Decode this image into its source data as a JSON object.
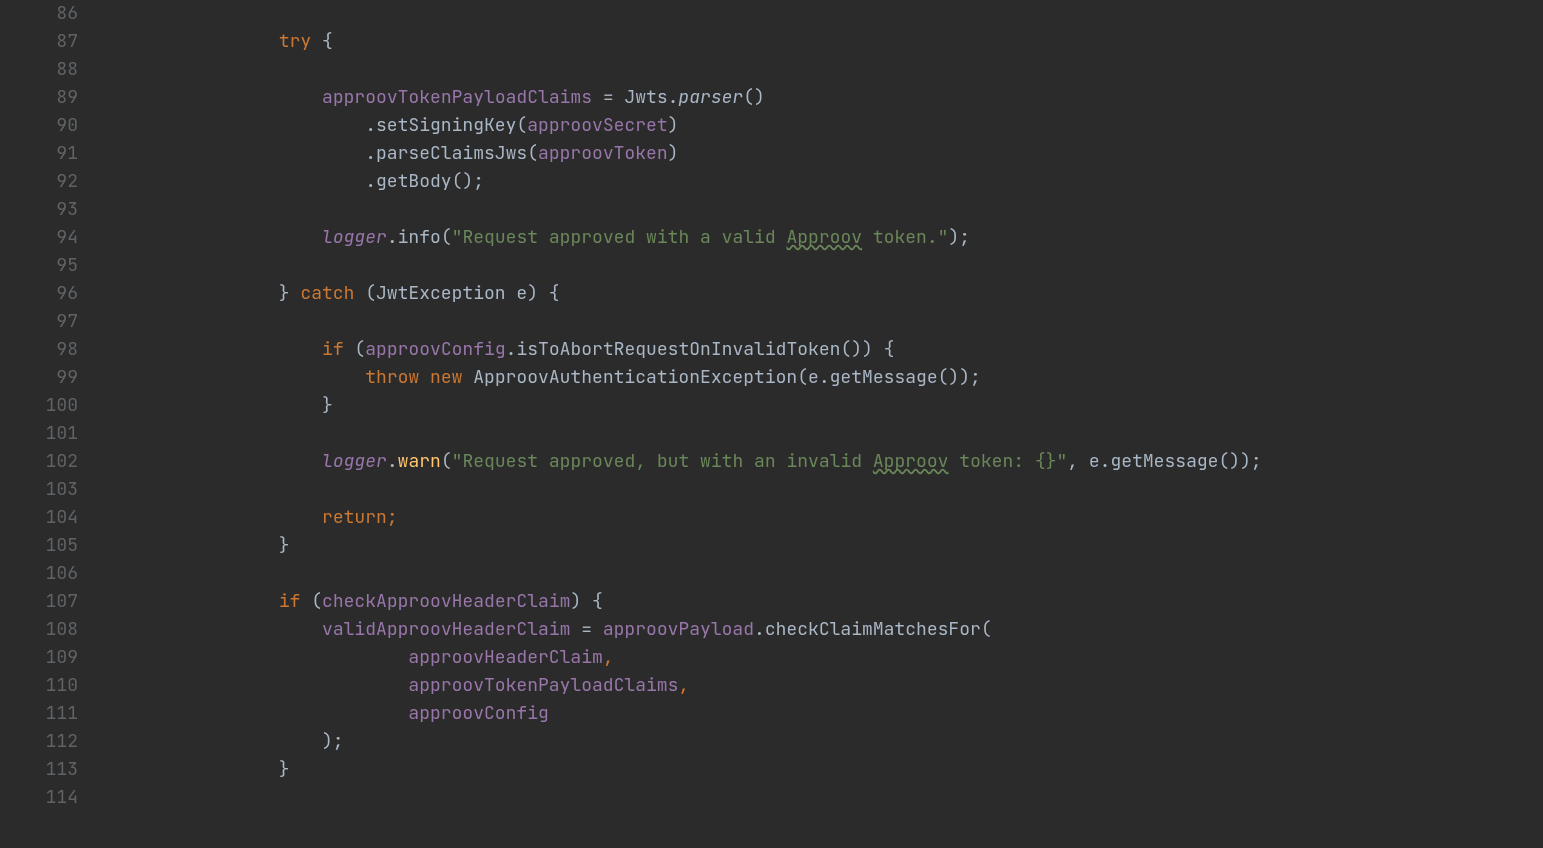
{
  "code_language": "java",
  "first_line_number": 86,
  "theme": {
    "background": "#2b2b2b",
    "default_text": "#A9B7C6",
    "gutter_text": "#606366",
    "keyword": "#CC7832",
    "identifier": "#A9B7C6",
    "field_variable": "#9876AA",
    "method_call": "#FFC66D",
    "string_literal": "#6A8759"
  },
  "lines": [
    {
      "n": 86,
      "tokens": []
    },
    {
      "n": 87,
      "tokens": [
        {
          "t": "        ",
          "c": "tok-id"
        },
        {
          "t": "try",
          "c": "tok-kw"
        },
        {
          "t": " {",
          "c": "tok-id"
        }
      ]
    },
    {
      "n": 88,
      "tokens": []
    },
    {
      "n": 89,
      "tokens": [
        {
          "t": "            ",
          "c": "tok-id"
        },
        {
          "t": "approovTokenPayloadClaims",
          "c": "tok-var"
        },
        {
          "t": " = Jwts.",
          "c": "tok-id"
        },
        {
          "t": "parser",
          "c": "tok-static-it"
        },
        {
          "t": "()",
          "c": "tok-id"
        }
      ]
    },
    {
      "n": 90,
      "tokens": [
        {
          "t": "                .setSigningKey(",
          "c": "tok-id"
        },
        {
          "t": "approovSecret",
          "c": "tok-var"
        },
        {
          "t": ")",
          "c": "tok-id"
        }
      ]
    },
    {
      "n": 91,
      "tokens": [
        {
          "t": "                .parseClaimsJws(",
          "c": "tok-id"
        },
        {
          "t": "approovToken",
          "c": "tok-var"
        },
        {
          "t": ")",
          "c": "tok-id"
        }
      ]
    },
    {
      "n": 92,
      "tokens": [
        {
          "t": "                .getBody();",
          "c": "tok-id"
        }
      ]
    },
    {
      "n": 93,
      "tokens": []
    },
    {
      "n": 94,
      "tokens": [
        {
          "t": "            ",
          "c": "tok-id"
        },
        {
          "t": "logger",
          "c": "tok-field-it"
        },
        {
          "t": ".info(",
          "c": "tok-id"
        },
        {
          "t": "\"Request approved with a valid ",
          "c": "tok-str"
        },
        {
          "t": "Approov",
          "c": "tok-spell"
        },
        {
          "t": " token.\"",
          "c": "tok-str"
        },
        {
          "t": ");",
          "c": "tok-id"
        }
      ]
    },
    {
      "n": 95,
      "tokens": []
    },
    {
      "n": 96,
      "tokens": [
        {
          "t": "        } ",
          "c": "tok-id"
        },
        {
          "t": "catch",
          "c": "tok-kw"
        },
        {
          "t": " (JwtException e) {",
          "c": "tok-id"
        }
      ]
    },
    {
      "n": 97,
      "tokens": []
    },
    {
      "n": 98,
      "tokens": [
        {
          "t": "            ",
          "c": "tok-id"
        },
        {
          "t": "if",
          "c": "tok-kw"
        },
        {
          "t": " (",
          "c": "tok-id"
        },
        {
          "t": "approovConfig",
          "c": "tok-var"
        },
        {
          "t": ".isToAbortRequestOnInvalidToken()) {",
          "c": "tok-id"
        }
      ]
    },
    {
      "n": 99,
      "tokens": [
        {
          "t": "                ",
          "c": "tok-id"
        },
        {
          "t": "throw new",
          "c": "tok-kw"
        },
        {
          "t": " ApproovAuthenticationException(e.getMessage());",
          "c": "tok-id"
        }
      ]
    },
    {
      "n": 100,
      "tokens": [
        {
          "t": "            }",
          "c": "tok-id"
        }
      ]
    },
    {
      "n": 101,
      "tokens": []
    },
    {
      "n": 102,
      "tokens": [
        {
          "t": "            ",
          "c": "tok-id"
        },
        {
          "t": "logger",
          "c": "tok-field-it"
        },
        {
          "t": ".",
          "c": "tok-id"
        },
        {
          "t": "warn",
          "c": "tok-meth"
        },
        {
          "t": "(",
          "c": "tok-id"
        },
        {
          "t": "\"Request approved, but with an invalid ",
          "c": "tok-str"
        },
        {
          "t": "Approov",
          "c": "tok-spell"
        },
        {
          "t": " token: {}\"",
          "c": "tok-str"
        },
        {
          "t": ", e.getMessage());",
          "c": "tok-id"
        }
      ]
    },
    {
      "n": 103,
      "tokens": []
    },
    {
      "n": 104,
      "tokens": [
        {
          "t": "            ",
          "c": "tok-id"
        },
        {
          "t": "return;",
          "c": "tok-kw"
        }
      ]
    },
    {
      "n": 105,
      "tokens": [
        {
          "t": "        }",
          "c": "tok-id"
        }
      ]
    },
    {
      "n": 106,
      "tokens": []
    },
    {
      "n": 107,
      "tokens": [
        {
          "t": "        ",
          "c": "tok-id"
        },
        {
          "t": "if",
          "c": "tok-kw"
        },
        {
          "t": " (",
          "c": "tok-id"
        },
        {
          "t": "checkApproovHeaderClaim",
          "c": "tok-var"
        },
        {
          "t": ") {",
          "c": "tok-id"
        }
      ]
    },
    {
      "n": 108,
      "tokens": [
        {
          "t": "            ",
          "c": "tok-id"
        },
        {
          "t": "validApproovHeaderClaim",
          "c": "tok-var"
        },
        {
          "t": " = ",
          "c": "tok-id"
        },
        {
          "t": "approovPayload",
          "c": "tok-var"
        },
        {
          "t": ".checkClaimMatchesFor(",
          "c": "tok-id"
        }
      ]
    },
    {
      "n": 109,
      "tokens": [
        {
          "t": "                    ",
          "c": "tok-id"
        },
        {
          "t": "approovHeaderClaim",
          "c": "tok-var"
        },
        {
          "t": ",",
          "c": "tok-kw"
        }
      ]
    },
    {
      "n": 110,
      "tokens": [
        {
          "t": "                    ",
          "c": "tok-id"
        },
        {
          "t": "approovTokenPayloadClaims",
          "c": "tok-var"
        },
        {
          "t": ",",
          "c": "tok-kw"
        }
      ]
    },
    {
      "n": 111,
      "tokens": [
        {
          "t": "                    ",
          "c": "tok-id"
        },
        {
          "t": "approovConfig",
          "c": "tok-var"
        }
      ]
    },
    {
      "n": 112,
      "tokens": [
        {
          "t": "            );",
          "c": "tok-id"
        }
      ]
    },
    {
      "n": 113,
      "tokens": [
        {
          "t": "        }",
          "c": "tok-id"
        }
      ]
    },
    {
      "n": 114,
      "tokens": []
    }
  ]
}
